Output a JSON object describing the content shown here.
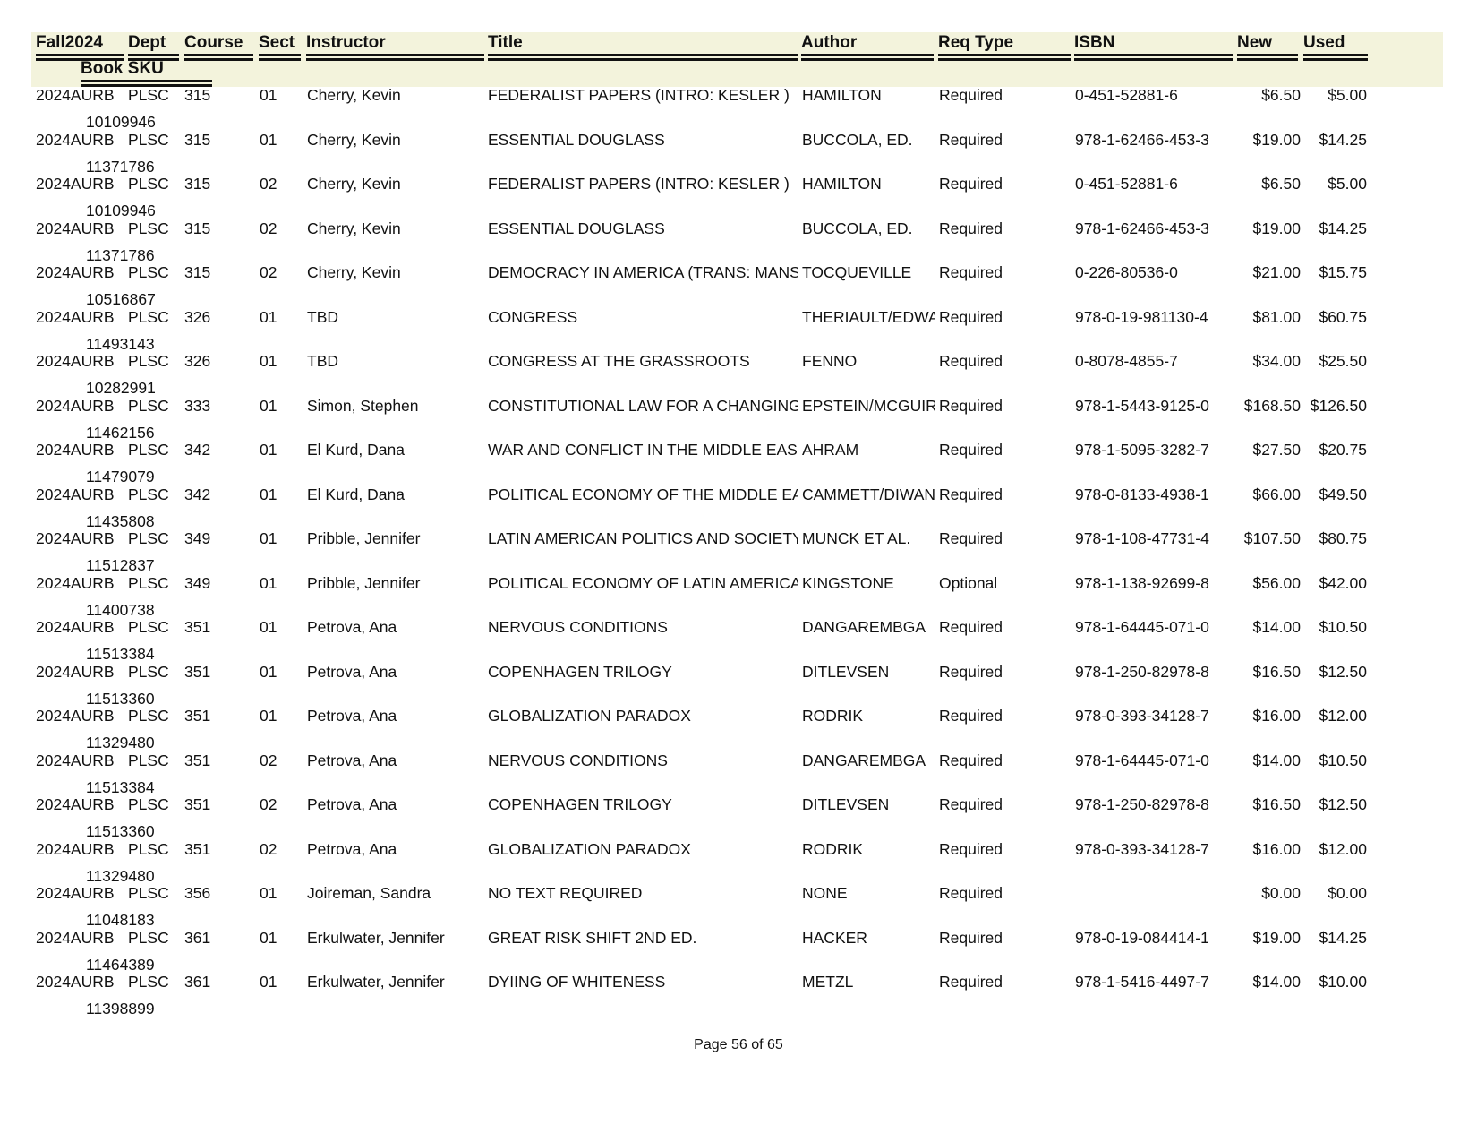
{
  "header": {
    "columns": [
      "Fall2024",
      "Dept",
      "Course",
      "Sect",
      "Instructor",
      "Title",
      "Author",
      "Req Type",
      "ISBN",
      "New",
      "Used"
    ],
    "sub_column": "Book SKU"
  },
  "rows": [
    {
      "term": "2024AURB",
      "dept": "PLSC",
      "course": "315",
      "sect": "01",
      "instructor": "Cherry, Kevin",
      "title": "FEDERALIST PAPERS (INTRO: KESLER )",
      "author": "HAMILTON",
      "req": "Required",
      "isbn": "0-451-52881-6",
      "new": "$6.50",
      "used": "$5.00",
      "sku": "10109946"
    },
    {
      "term": "2024AURB",
      "dept": "PLSC",
      "course": "315",
      "sect": "01",
      "instructor": "Cherry, Kevin",
      "title": "ESSENTIAL DOUGLASS",
      "author": "BUCCOLA, ED.",
      "req": "Required",
      "isbn": "978-1-62466-453-3",
      "new": "$19.00",
      "used": "$14.25",
      "sku": "11371786"
    },
    {
      "term": "2024AURB",
      "dept": "PLSC",
      "course": "315",
      "sect": "02",
      "instructor": "Cherry, Kevin",
      "title": "FEDERALIST PAPERS (INTRO: KESLER )",
      "author": "HAMILTON",
      "req": "Required",
      "isbn": "0-451-52881-6",
      "new": "$6.50",
      "used": "$5.00",
      "sku": "10109946"
    },
    {
      "term": "2024AURB",
      "dept": "PLSC",
      "course": "315",
      "sect": "02",
      "instructor": "Cherry, Kevin",
      "title": "ESSENTIAL DOUGLASS",
      "author": "BUCCOLA, ED.",
      "req": "Required",
      "isbn": "978-1-62466-453-3",
      "new": "$19.00",
      "used": "$14.25",
      "sku": "11371786"
    },
    {
      "term": "2024AURB",
      "dept": "PLSC",
      "course": "315",
      "sect": "02",
      "instructor": "Cherry, Kevin",
      "title": "DEMOCRACY IN AMERICA (TRANS: MANSFIELD)",
      "author": "TOCQUEVILLE",
      "req": "Required",
      "isbn": "0-226-80536-0",
      "new": "$21.00",
      "used": "$15.75",
      "sku": "10516867"
    },
    {
      "term": "2024AURB",
      "dept": "PLSC",
      "course": "326",
      "sect": "01",
      "instructor": "TBD",
      "title": "CONGRESS",
      "author": "THERIAULT/EDWARDS",
      "req": "Required",
      "isbn": "978-0-19-981130-4",
      "new": "$81.00",
      "used": "$60.75",
      "sku": "11493143"
    },
    {
      "term": "2024AURB",
      "dept": "PLSC",
      "course": "326",
      "sect": "01",
      "instructor": "TBD",
      "title": "CONGRESS AT THE GRASSROOTS",
      "author": "FENNO",
      "req": "Required",
      "isbn": "0-8078-4855-7",
      "new": "$34.00",
      "used": "$25.50",
      "sku": "10282991"
    },
    {
      "term": "2024AURB",
      "dept": "PLSC",
      "course": "333",
      "sect": "01",
      "instructor": "Simon, Stephen",
      "title": "CONSTITUTIONAL LAW FOR A CHANGING AMERICA",
      "author": "EPSTEIN/MCGUIRE",
      "req": "Required",
      "isbn": "978-1-5443-9125-0",
      "new": "$168.50",
      "used": "$126.50",
      "sku": "11462156"
    },
    {
      "term": "2024AURB",
      "dept": "PLSC",
      "course": "342",
      "sect": "01",
      "instructor": "El Kurd, Dana",
      "title": "WAR AND CONFLICT IN THE MIDDLE EAST",
      "author": "AHRAM",
      "req": "Required",
      "isbn": "978-1-5095-3282-7",
      "new": "$27.50",
      "used": "$20.75",
      "sku": "11479079"
    },
    {
      "term": "2024AURB",
      "dept": "PLSC",
      "course": "342",
      "sect": "01",
      "instructor": "El Kurd, Dana",
      "title": "POLITICAL ECONOMY OF THE MIDDLE EAST",
      "author": "CAMMETT/DIWAN",
      "req": "Required",
      "isbn": "978-0-8133-4938-1",
      "new": "$66.00",
      "used": "$49.50",
      "sku": "11435808"
    },
    {
      "term": "2024AURB",
      "dept": "PLSC",
      "course": "349",
      "sect": "01",
      "instructor": "Pribble, Jennifer",
      "title": "LATIN AMERICAN POLITICS AND SOCIETY",
      "author": "MUNCK ET AL.",
      "req": "Required",
      "isbn": "978-1-108-47731-4",
      "new": "$107.50",
      "used": "$80.75",
      "sku": "11512837"
    },
    {
      "term": "2024AURB",
      "dept": "PLSC",
      "course": "349",
      "sect": "01",
      "instructor": "Pribble, Jennifer",
      "title": "POLITICAL ECONOMY OF LATIN AMERICA",
      "author": "KINGSTONE",
      "req": "Optional",
      "isbn": "978-1-138-92699-8",
      "new": "$56.00",
      "used": "$42.00",
      "sku": "11400738"
    },
    {
      "term": "2024AURB",
      "dept": "PLSC",
      "course": "351",
      "sect": "01",
      "instructor": "Petrova, Ana",
      "title": "NERVOUS CONDITIONS",
      "author": "DANGAREMBGA",
      "req": "Required",
      "isbn": "978-1-64445-071-0",
      "new": "$14.00",
      "used": "$10.50",
      "sku": "11513384"
    },
    {
      "term": "2024AURB",
      "dept": "PLSC",
      "course": "351",
      "sect": "01",
      "instructor": "Petrova, Ana",
      "title": "COPENHAGEN TRILOGY",
      "author": "DITLEVSEN",
      "req": "Required",
      "isbn": "978-1-250-82978-8",
      "new": "$16.50",
      "used": "$12.50",
      "sku": "11513360"
    },
    {
      "term": "2024AURB",
      "dept": "PLSC",
      "course": "351",
      "sect": "01",
      "instructor": "Petrova, Ana",
      "title": "GLOBALIZATION PARADOX",
      "author": "RODRIK",
      "req": "Required",
      "isbn": "978-0-393-34128-7",
      "new": "$16.00",
      "used": "$12.00",
      "sku": "11329480"
    },
    {
      "term": "2024AURB",
      "dept": "PLSC",
      "course": "351",
      "sect": "02",
      "instructor": "Petrova, Ana",
      "title": "NERVOUS CONDITIONS",
      "author": "DANGAREMBGA",
      "req": "Required",
      "isbn": "978-1-64445-071-0",
      "new": "$14.00",
      "used": "$10.50",
      "sku": "11513384"
    },
    {
      "term": "2024AURB",
      "dept": "PLSC",
      "course": "351",
      "sect": "02",
      "instructor": "Petrova, Ana",
      "title": "COPENHAGEN TRILOGY",
      "author": "DITLEVSEN",
      "req": "Required",
      "isbn": "978-1-250-82978-8",
      "new": "$16.50",
      "used": "$12.50",
      "sku": "11513360"
    },
    {
      "term": "2024AURB",
      "dept": "PLSC",
      "course": "351",
      "sect": "02",
      "instructor": "Petrova, Ana",
      "title": "GLOBALIZATION PARADOX",
      "author": "RODRIK",
      "req": "Required",
      "isbn": "978-0-393-34128-7",
      "new": "$16.00",
      "used": "$12.00",
      "sku": "11329480"
    },
    {
      "term": "2024AURB",
      "dept": "PLSC",
      "course": "356",
      "sect": "01",
      "instructor": "Joireman, Sandra",
      "title": "NO TEXT REQUIRED",
      "author": "NONE",
      "req": "Required",
      "isbn": "",
      "new": "$0.00",
      "used": "$0.00",
      "sku": "11048183"
    },
    {
      "term": "2024AURB",
      "dept": "PLSC",
      "course": "361",
      "sect": "01",
      "instructor": "Erkulwater, Jennifer",
      "title": "GREAT RISK SHIFT 2ND ED.",
      "author": "HACKER",
      "req": "Required",
      "isbn": "978-0-19-084414-1",
      "new": "$19.00",
      "used": "$14.25",
      "sku": "11464389"
    },
    {
      "term": "2024AURB",
      "dept": "PLSC",
      "course": "361",
      "sect": "01",
      "instructor": "Erkulwater, Jennifer",
      "title": "DYIING OF WHITENESS",
      "author": "METZL",
      "req": "Required",
      "isbn": "978-1-5416-4497-7",
      "new": "$14.00",
      "used": "$10.00",
      "sku": "11398899"
    }
  ],
  "footer": {
    "page_label": "Page 56 of 65"
  }
}
